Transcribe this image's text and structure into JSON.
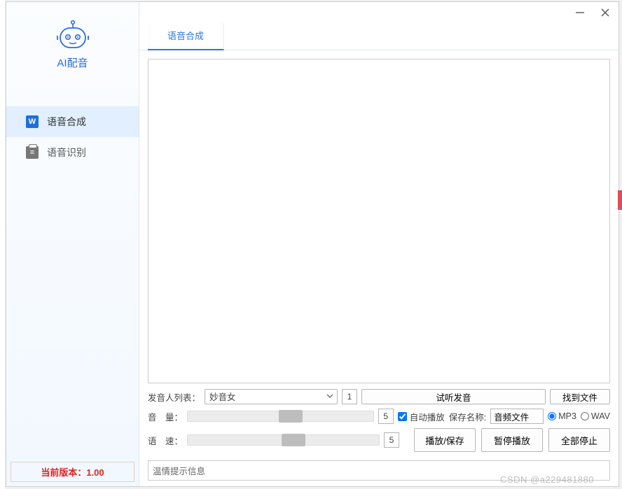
{
  "app": {
    "title": "AI配音"
  },
  "sidebar": {
    "items": [
      {
        "label": "语音合成"
      },
      {
        "label": "语音识别"
      }
    ],
    "version_label": "当前版本：1.00"
  },
  "tabs": [
    {
      "label": "语音合成"
    }
  ],
  "controls": {
    "voice_list_label": "发音人列表：",
    "voice_selected": "妙音女",
    "voice_count": "1",
    "preview_btn": "试听发音",
    "find_file_btn": "找到文件",
    "volume_label": "音　量：",
    "volume_value": "5",
    "autoplay_label": "自动播放",
    "autoplay_checked": true,
    "save_name_label": "保存名称:",
    "save_name_value": "音频文件",
    "format_mp3": "MP3",
    "format_wav": "WAV",
    "format_selected": "MP3",
    "speed_label": "语　速：",
    "speed_value": "5",
    "play_save_btn": "播放/保存",
    "pause_btn": "暂停播放",
    "stop_all_btn": "全部停止"
  },
  "status": {
    "text": "温情提示信息"
  },
  "watermark": "CSDN @a229481880"
}
